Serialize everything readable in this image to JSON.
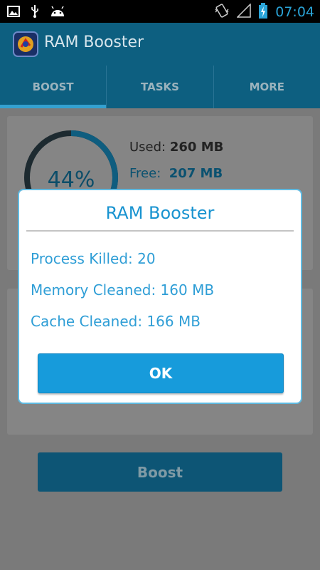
{
  "status_bar": {
    "time": "07:04",
    "icons": [
      "image-icon",
      "usb-icon",
      "android-icon",
      "vibrate-icon",
      "signal-icon",
      "battery-charging-icon"
    ]
  },
  "action_bar": {
    "title": "RAM Booster",
    "icon": "ram-booster-app-icon"
  },
  "tabs": [
    {
      "label": "BOOST",
      "active": true
    },
    {
      "label": "TASKS",
      "active": false
    },
    {
      "label": "MORE",
      "active": false
    }
  ],
  "memory": {
    "percent_label": "44%",
    "percent_value": 44,
    "used_label": "Used:",
    "used_value": "260 MB",
    "free_label": "Free:",
    "free_value": "207 MB"
  },
  "boost_button": {
    "label": "Boost"
  },
  "dialog": {
    "title": "RAM Booster",
    "process_killed": "Process Killed: 20",
    "memory_cleaned": "Memory Cleaned: 160 MB",
    "cache_cleaned": "Cache Cleaned: 166 MB",
    "ok_label": "OK"
  },
  "colors": {
    "accent": "#179bdb",
    "dialog_text": "#2f9ed6",
    "action_bar": "#0d5f80",
    "status_time": "#2aa4d8"
  }
}
